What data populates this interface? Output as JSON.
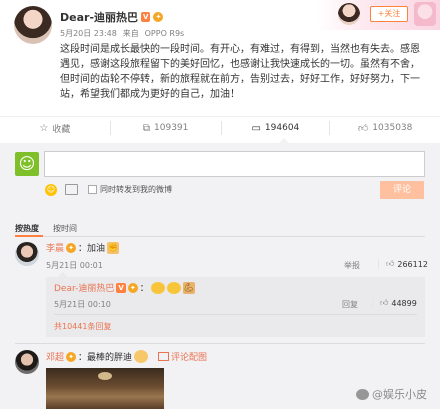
{
  "header": {
    "username": "Dear-迪丽热巴",
    "follow_label": "+关注",
    "time": "5月20日 23:48",
    "source_prefix": "来自",
    "device": "OPPO R9s"
  },
  "post": {
    "text": "这段时间是成长最快的一段时间。有开心，有难过，有得到，当然也有失去。感恩遇见，感谢这段旅程留下的美好回忆，也感谢让我快速成长的一切。虽然有不舍，但时间的齿轮不停转，新的旅程就在前方，告别过去，好好工作，好好努力，下一站，希望我们都成为更好的自己，加油！"
  },
  "actions": {
    "favorite": "收藏",
    "repost": "109391",
    "comment": "194604",
    "like": "1035038"
  },
  "composer": {
    "input_value": "",
    "checkbox_label": "同时转发到我的微博",
    "submit_label": "评论"
  },
  "tabs": {
    "hot": "按热度",
    "time": "按时间"
  },
  "comments": [
    {
      "user": "李晨",
      "text": "：加油",
      "time": "5月21日 00:01",
      "report": "举报",
      "likes": "266112"
    },
    {
      "user": "Dear-迪丽热巴",
      "text": "：",
      "time": "5月21日 00:10",
      "reply": "回复",
      "likes": "44899"
    },
    {
      "total_replies": "共10441条回复"
    },
    {
      "user": "邓超",
      "text": "：最棒的胖迪",
      "image_label": "评论配图"
    }
  ],
  "watermark": "@娱乐小皮",
  "colors": {
    "accent": "#eb7350",
    "button": "#ffc09f",
    "text": "#333333",
    "muted": "#808080"
  }
}
